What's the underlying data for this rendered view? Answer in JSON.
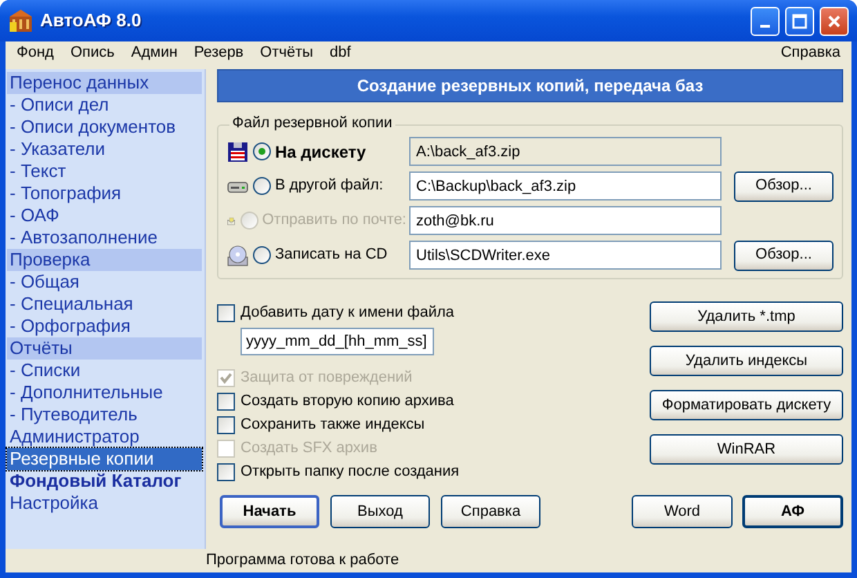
{
  "window": {
    "title": "АвтоАФ 8.0"
  },
  "menu": {
    "items": [
      "Фонд",
      "Опись",
      "Админ",
      "Резерв",
      "Отчёты",
      "dbf"
    ],
    "right_items": [
      "Справка"
    ]
  },
  "sidebar": {
    "items": [
      {
        "label": "Перенос данных",
        "kind": "header",
        "selected": false,
        "children": [
          {
            "label": "- Описи дел",
            "kind": "item",
            "selected": false
          },
          {
            "label": "- Описи документов",
            "kind": "item",
            "selected": false
          },
          {
            "label": "- Указатели",
            "kind": "item",
            "selected": false
          },
          {
            "label": "- Текст",
            "kind": "item",
            "selected": false
          },
          {
            "label": "- Топография",
            "kind": "item",
            "selected": false
          },
          {
            "label": "- ОАФ",
            "kind": "item",
            "selected": false
          },
          {
            "label": "- Автозаполнение",
            "kind": "item",
            "selected": false
          }
        ]
      },
      {
        "label": "Проверка",
        "kind": "header",
        "selected": false,
        "children": [
          {
            "label": "- Общая",
            "kind": "item",
            "selected": false
          },
          {
            "label": "- Специальная",
            "kind": "item",
            "selected": false
          },
          {
            "label": "- Орфография",
            "kind": "item",
            "selected": false
          }
        ]
      },
      {
        "label": "Отчёты",
        "kind": "header",
        "selected": false,
        "children": [
          {
            "label": "- Списки",
            "kind": "item",
            "selected": false
          },
          {
            "label": "- Дополнительные",
            "kind": "item",
            "selected": false
          },
          {
            "label": "- Путеводитель",
            "kind": "item",
            "selected": false
          }
        ]
      },
      {
        "label": "Администратор",
        "kind": "item",
        "selected": false
      },
      {
        "label": "Резервные копии",
        "kind": "item",
        "selected": true
      },
      {
        "label": "Фондовый Каталог",
        "kind": "bold",
        "selected": false
      },
      {
        "label": "Настройка",
        "kind": "item",
        "selected": false
      }
    ]
  },
  "panel": {
    "title": "Создание резервных копий, передача баз",
    "group": {
      "title": "Файл резервной копии",
      "options": [
        {
          "label": "На дискету",
          "selected": true,
          "disabled": false,
          "value": "A:\\back_af3.zip",
          "readonly": true
        },
        {
          "label": "В другой файл:",
          "selected": false,
          "disabled": false,
          "value": "C:\\Backup\\back_af3.zip",
          "readonly": false,
          "browse": "Обзор..."
        },
        {
          "label": "Отправить по почте:",
          "selected": false,
          "disabled": true,
          "value": "zoth@bk.ru",
          "readonly": false
        },
        {
          "label": "Записать на CD",
          "selected": false,
          "disabled": false,
          "value": "Utils\\SCDWriter.exe",
          "readonly": false,
          "browse": "Обзор..."
        }
      ]
    },
    "checkboxes": [
      {
        "label": "Добавить дату к имени файла",
        "checked": false,
        "disabled": false,
        "field_value": "yyyy_mm_dd_[hh_mm_ss]"
      },
      {
        "label": "Защита от повреждений",
        "checked": true,
        "disabled": true
      },
      {
        "label": "Создать вторую копию архива",
        "checked": false,
        "disabled": false
      },
      {
        "label": "Сохранить также индексы",
        "checked": false,
        "disabled": false
      },
      {
        "label": "Создать SFX архив",
        "checked": false,
        "disabled": true
      },
      {
        "label": "Открыть папку после создания",
        "checked": false,
        "disabled": false
      }
    ],
    "side_buttons": [
      "Удалить *.tmp",
      "Удалить индексы",
      "Форматировать дискету",
      "WinRAR"
    ],
    "bottom_left": [
      {
        "label": "Начать",
        "bold": true
      },
      {
        "label": "Выход",
        "bold": false
      },
      {
        "label": "Справка",
        "bold": false
      }
    ],
    "bottom_right": [
      {
        "label": "Word",
        "bold": false
      },
      {
        "label": "АФ",
        "bold": true
      }
    ]
  },
  "status_bar": "Программа готова к работе"
}
